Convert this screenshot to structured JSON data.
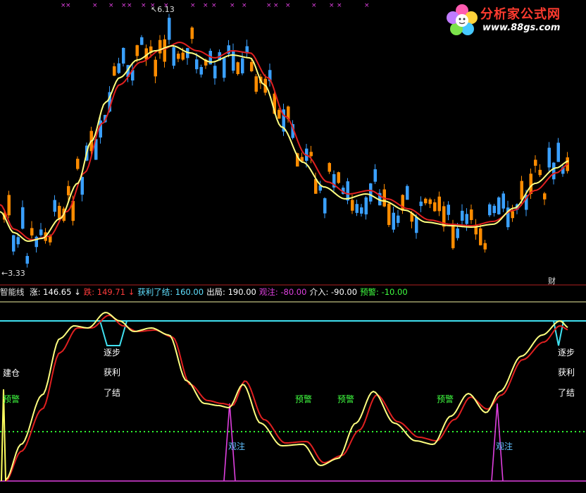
{
  "watermark": {
    "title": "分析家公式网",
    "url": "www.88gs.com"
  },
  "price_panel": {
    "high_label": "6.13",
    "low_label": "3.33",
    "cai_label": "财"
  },
  "indicator_bar": {
    "name": "智能线",
    "items": [
      {
        "label": "涨:",
        "value": "146.65",
        "arrow": "↓",
        "color": "#ffffff"
      },
      {
        "label": "跌:",
        "value": "149.71",
        "arrow": "↓",
        "color": "#ff3b3b"
      },
      {
        "label": "获利了结:",
        "value": "160.00",
        "arrow": "",
        "color": "#60e0ff"
      },
      {
        "label": "出局:",
        "value": "190.00",
        "arrow": "",
        "color": "#ffffff"
      },
      {
        "label": "观注:",
        "value": "-80.00",
        "arrow": "",
        "color": "#e040e0"
      },
      {
        "label": "介入:",
        "value": "-90.00",
        "arrow": "",
        "color": "#ffffff"
      },
      {
        "label": "预警:",
        "value": "-10.00",
        "arrow": "",
        "color": "#40ff40"
      }
    ]
  },
  "annotations": {
    "build": "建仓",
    "warn": "预警",
    "step": "逐步",
    "profit": "获利",
    "close": "了结",
    "watch": "观注"
  },
  "chart_data": {
    "type": "candlestick+line",
    "title": "",
    "price_range_visible": [
      3.33,
      6.13
    ],
    "series": [
      {
        "name": "涨",
        "value": 146.65
      },
      {
        "name": "跌",
        "value": 149.71
      }
    ],
    "levels": {
      "获利了结": 160.0,
      "出局": 190.0,
      "观注": -80.0,
      "介入": -90.0,
      "预警": -10.0
    },
    "colors": {
      "up_candle": "#ff8c00",
      "down_candle": "#3aa0ff",
      "fast_line": "#ffff80",
      "slow_line": "#e02020",
      "profit_line": "#40e0f0",
      "watch_line": "#e040e0",
      "warn_dots": "#40ff40"
    }
  }
}
